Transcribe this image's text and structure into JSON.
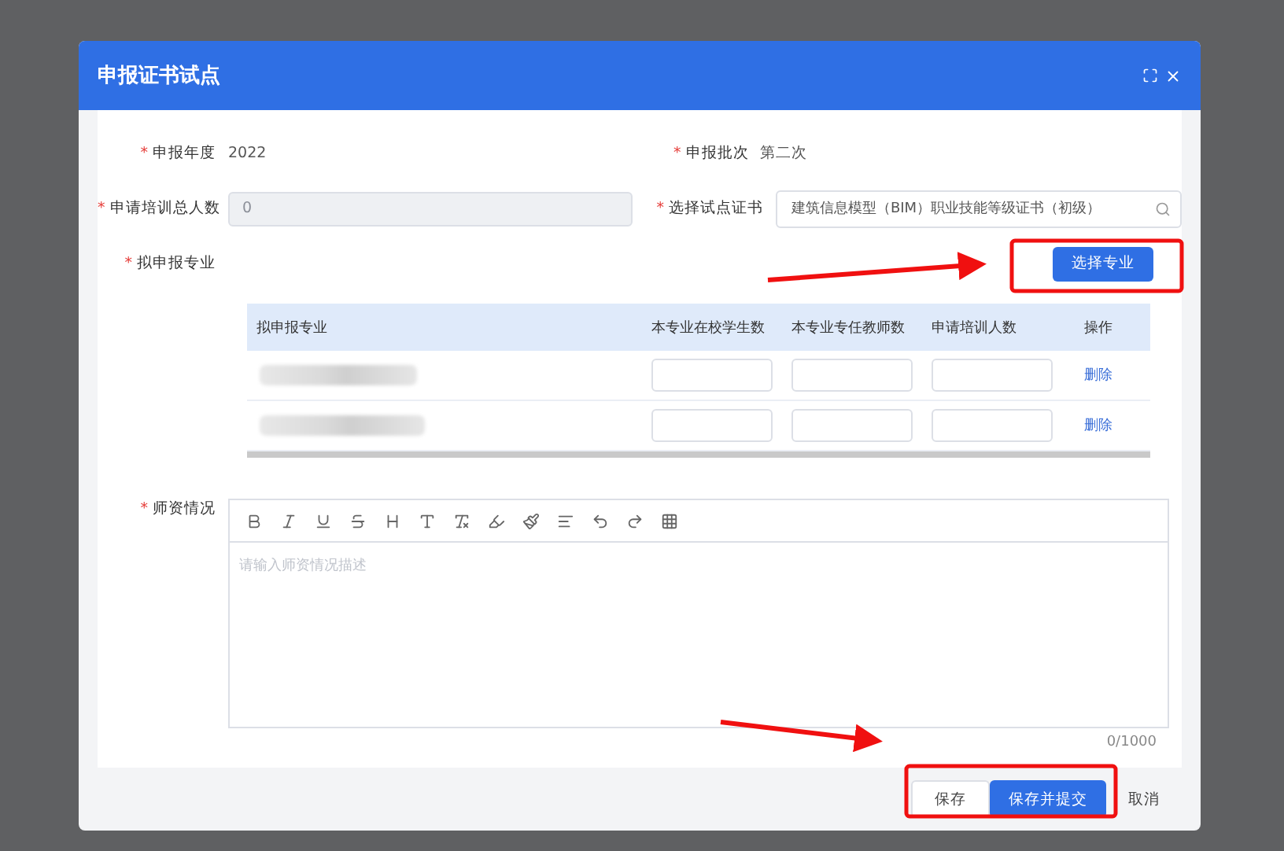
{
  "dialog": {
    "title": "申报证书试点"
  },
  "form": {
    "year": {
      "label": "申报年度",
      "value": "2022",
      "required_mark": "*"
    },
    "batch": {
      "label": "申报批次",
      "value": "第二次",
      "required_mark": "*"
    },
    "total": {
      "label": "申请培训总人数",
      "placeholder": "0",
      "disabled": true,
      "required_mark": "*"
    },
    "certificate": {
      "label": "选择试点证书",
      "value": "建筑信息模型（BIM）职业技能等级证书（初级）",
      "required_mark": "*"
    },
    "majors": {
      "label": "拟申报专业",
      "button": "选择专业",
      "required_mark": "*"
    }
  },
  "table": {
    "columns": [
      "拟申报专业",
      "本专业在校学生数",
      "本专业专任教师数",
      "申请培训人数",
      "操作"
    ],
    "rows": [
      {
        "action": "删除"
      },
      {
        "action": "删除"
      }
    ]
  },
  "editor": {
    "label": "师资情况",
    "required_mark": "*",
    "placeholder": "请输入师资情况描述",
    "counter": "0/1000"
  },
  "buttons": [
    {
      "label": "保存",
      "kind": "default"
    },
    {
      "label": "保存并提交",
      "kind": "primary"
    },
    {
      "label": "取消",
      "kind": "text"
    }
  ]
}
